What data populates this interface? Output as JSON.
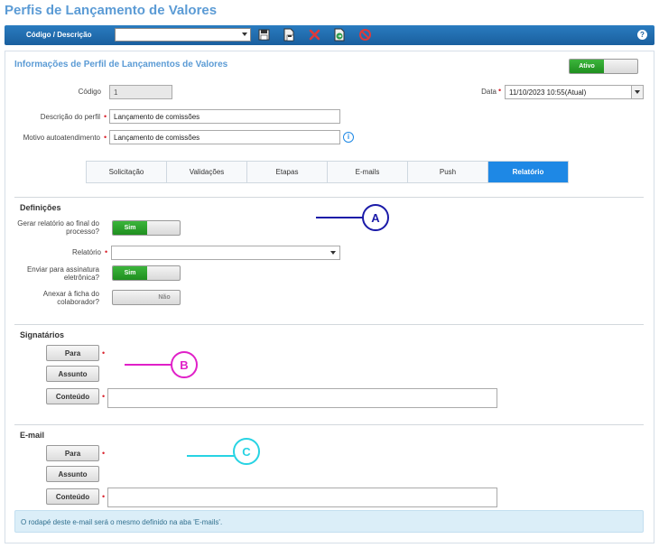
{
  "page": {
    "title": "Perfis de Lançamento de Valores"
  },
  "toolbar": {
    "label": "Código / Descrição",
    "help": "?"
  },
  "section": {
    "title": "Informações de Perfil de Lançamentos de Valores",
    "status_toggle": "Ativo"
  },
  "form": {
    "codigo_label": "Código",
    "codigo_value": "1",
    "data_label": "Data",
    "data_value": "11/10/2023 10:55(Atual)",
    "descricao_label": "Descrição do perfil",
    "descricao_value": "Lançamento de comissões",
    "motivo_label": "Motivo autoatendimento",
    "motivo_value": "Lançamento de comissões",
    "required_mark": "•",
    "info_icon": "i"
  },
  "tabs": [
    "Solicitação",
    "Validações",
    "Etapas",
    "E-mails",
    "Push",
    "Relatório"
  ],
  "definicoes": {
    "title": "Definições",
    "gerar_label_1": "Gerar relatório ao final do",
    "gerar_label_2": "processo?",
    "gerar_value": "Sim",
    "relatorio_label": "Relatório",
    "assinatura_label_1": "Enviar para assinatura",
    "assinatura_label_2": "eletrônica?",
    "assinatura_value": "Sim",
    "anexar_label_1": "Anexar à ficha do",
    "anexar_label_2": "colaborador?",
    "anexar_value": "Não"
  },
  "signatarios": {
    "title": "Signatários",
    "para": "Para",
    "assunto": "Assunto",
    "conteudo": "Conteúdo"
  },
  "email": {
    "title": "E-mail",
    "para": "Para",
    "assunto": "Assunto",
    "conteudo": "Conteúdo",
    "info": "O rodapé deste e-mail será o mesmo definido na aba 'E-mails'."
  },
  "markers": {
    "a": {
      "label": "A",
      "color": "#1a1aa8"
    },
    "b": {
      "label": "B",
      "color": "#e020c8"
    },
    "c": {
      "label": "C",
      "color": "#27d3e3"
    }
  }
}
